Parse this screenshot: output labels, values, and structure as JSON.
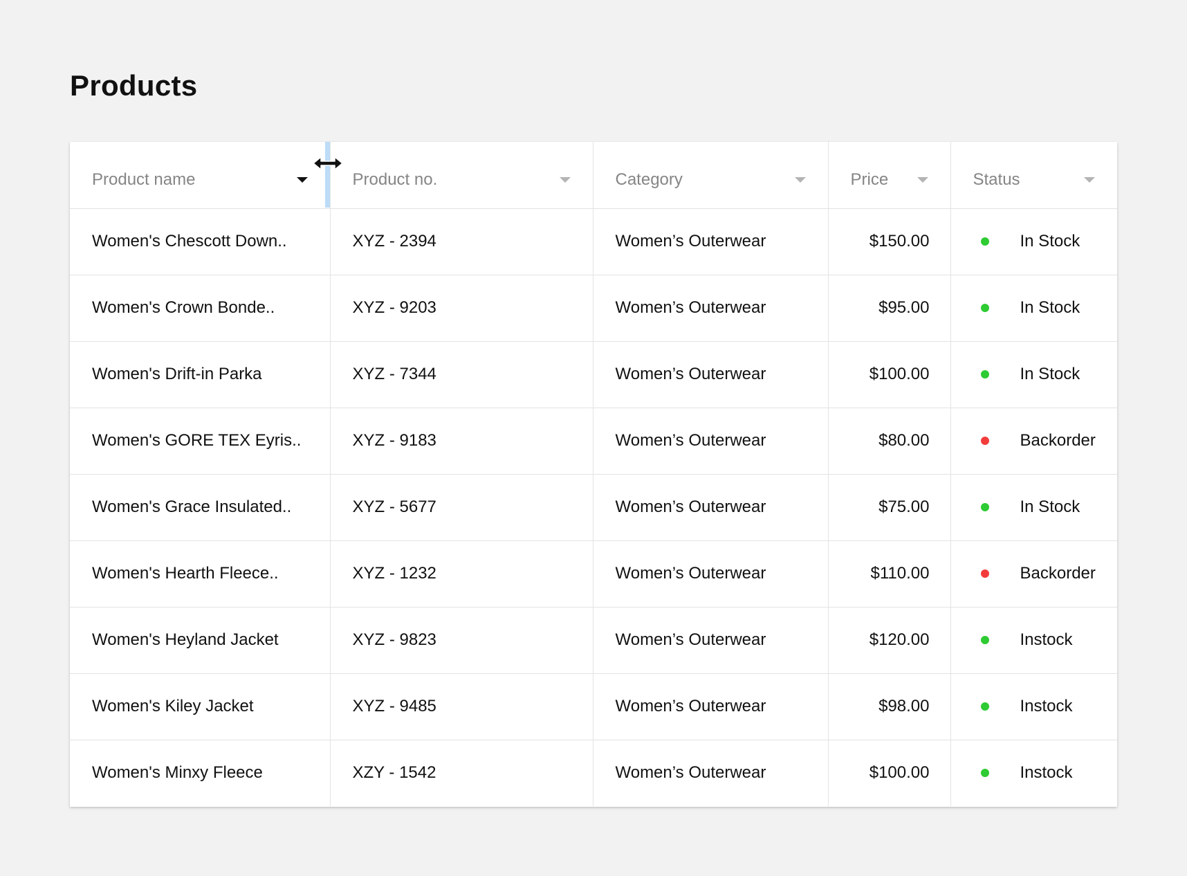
{
  "page": {
    "title": "Products"
  },
  "colors": {
    "in_stock": "#2ecb33",
    "backorder": "#f23c3c",
    "resize_handle": "#bcdcf7"
  },
  "table": {
    "columns": [
      {
        "label": "Product name",
        "icon": "caret-down-icon",
        "sort_active": true
      },
      {
        "label": "Product no.",
        "icon": "caret-down-icon",
        "sort_active": false
      },
      {
        "label": "Category",
        "icon": "caret-down-icon",
        "sort_active": false
      },
      {
        "label": "Price",
        "icon": "caret-down-icon",
        "sort_active": false
      },
      {
        "label": "Status",
        "icon": "caret-down-icon",
        "sort_active": false
      }
    ],
    "resize_cursor_icon": "resize-horizontal-icon",
    "rows": [
      {
        "name": "Women's Chescott Down..",
        "number": "XYZ - 2394",
        "category": "Women’s Outerwear",
        "price": "$150.00",
        "status": "In Stock",
        "status_color": "green"
      },
      {
        "name": "Women's Crown Bonde..",
        "number": "XYZ - 9203",
        "category": "Women’s Outerwear",
        "price": "$95.00",
        "status": "In Stock",
        "status_color": "green"
      },
      {
        "name": "Women's Drift-in Parka",
        "number": "XYZ - 7344",
        "category": "Women’s Outerwear",
        "price": "$100.00",
        "status": "In Stock",
        "status_color": "green"
      },
      {
        "name": "Women's GORE TEX Eyris..",
        "number": "XYZ - 9183",
        "category": "Women’s Outerwear",
        "price": "$80.00",
        "status": "Backorder",
        "status_color": "red"
      },
      {
        "name": "Women's Grace Insulated..",
        "number": "XYZ - 5677",
        "category": "Women’s Outerwear",
        "price": "$75.00",
        "status": "In Stock",
        "status_color": "green"
      },
      {
        "name": "Women's  Hearth Fleece..",
        "number": "XYZ - 1232",
        "category": "Women’s Outerwear",
        "price": "$110.00",
        "status": "Backorder",
        "status_color": "red"
      },
      {
        "name": "Women's Heyland Jacket",
        "number": "XYZ - 9823",
        "category": "Women’s Outerwear",
        "price": "$120.00",
        "status": "Instock",
        "status_color": "green"
      },
      {
        "name": "Women's Kiley Jacket",
        "number": "XYZ - 9485",
        "category": "Women’s Outerwear",
        "price": "$98.00",
        "status": "Instock",
        "status_color": "green"
      },
      {
        "name": "Women's Minxy Fleece",
        "number": "XZY - 1542",
        "category": "Women’s Outerwear",
        "price": "$100.00",
        "status": "Instock",
        "status_color": "green"
      }
    ]
  }
}
